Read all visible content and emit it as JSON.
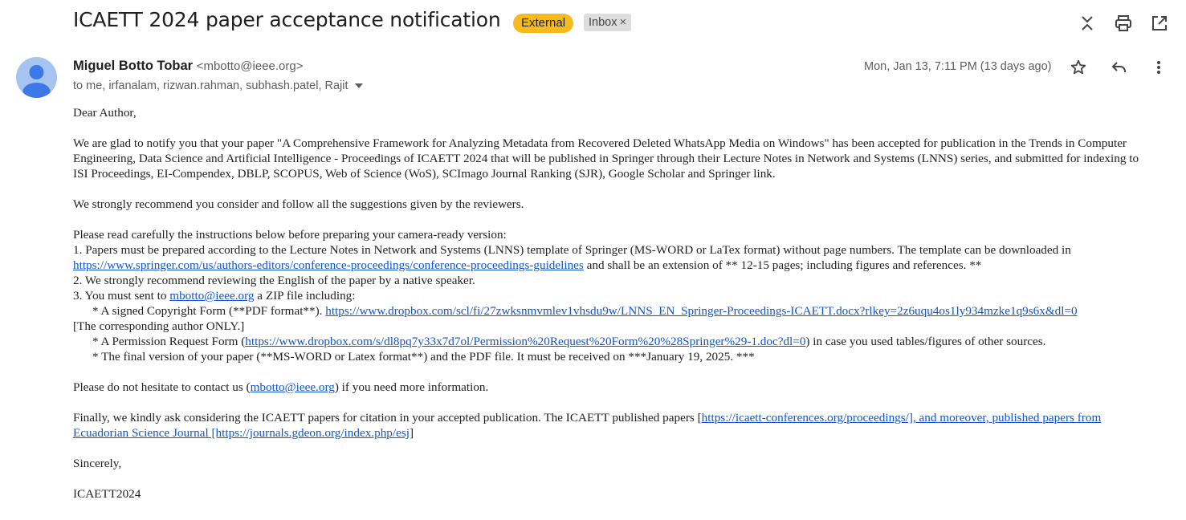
{
  "header": {
    "subject": "ICAETT 2024 paper acceptance notification",
    "label_external": "External",
    "label_inbox": "Inbox",
    "label_remove": "×",
    "icons": [
      "expand-collapse-icon",
      "print-icon",
      "open-in-new-window-icon"
    ]
  },
  "message": {
    "sender_name": "Miguel Botto Tobar",
    "sender_email": "<mbotto@ieee.org>",
    "recipients": "to me, irfanalam, rizwan.rahman, subhash.patel, Rajit",
    "date": "Mon, Jan 13, 7:11 PM (13 days ago)",
    "icons": [
      "star-icon",
      "reply-icon",
      "more-vert-icon"
    ]
  },
  "body": {
    "greeting": "Dear Author,",
    "p1": "We are glad to notify you that your paper \"A Comprehensive Framework for Analyzing Metadata from Recovered Deleted WhatsApp Media on Windows\" has been accepted for publication in the Trends in Computer Engineering, Data Science and Artificial Intelligence - Proceedings of ICAETT 2024 that will be published in Springer through their Lecture Notes in Network and Systems (LNNS) series, and submitted for indexing to ISI Proceedings, EI-Compendex, DBLP, SCOPUS, Web of Science (WoS), SCImago Journal Ranking (SJR), Google Scholar and Springer link.",
    "p2": "We strongly recommend you consider and follow all the suggestions given by the reviewers.",
    "p3_intro": "Please read carefully the instructions below before preparing your camera-ready version:",
    "item1_a": "1. Papers must be prepared according to the Lecture Notes in Network and Systems (LNNS) template of Springer (MS-WORD or LaTex format) without page numbers. The template can be downloaded in ",
    "item1_link": "https://www.springer.com/us/authors-editors/conference-proceedings/conference-proceedings-guidelines",
    "item1_b": " and shall be an extension of ** 12-15 pages; including figures and references. **",
    "item2": "2. We strongly recommend reviewing the English of the paper by a native speaker.",
    "item3_a": "3. You must sent to ",
    "item3_link": "mbotto@ieee.org",
    "item3_b": " a ZIP file including:",
    "sub1_a": "* A signed Copyright Form (**PDF format**). ",
    "sub1_link": "https://www.dropbox.com/scl/fi/27zwksnmvmlev1vhsdu9w/LNNS_EN_Springer-Proceedings-ICAETT.docx?rlkey=2z6uqu4os1ly934mzke1q9s6x&dl=0",
    "sub1_b": " [The corresponding author ONLY.]",
    "sub2_a": "* A Permission Request Form (",
    "sub2_link": "https://www.dropbox.com/s/dl8pq7y33x7d7ol/Permission%20Request%20Form%20%28Springer%29-1.doc?dl=0",
    "sub2_b": ") in case you used tables/figures of other sources.",
    "sub3": "* The final version of your paper (**MS-WORD or Latex format**) and the PDF file. It must be received on ***January 19, 2025. ***",
    "p4_a": "Please do not hesitate to contact us (",
    "p4_link": "mbotto@ieee.org",
    "p4_b": ") if you need more information.",
    "p5_a": "Finally, we kindly ask considering the ICAETT papers for citation in your accepted publication. The ICAETT published papers [",
    "p5_link": "https://icaett-conferences.org/proceedings/], and moreover, published papers from Ecuadorian Science Journal [https://journals.gdeon.org/index.php/esj",
    "p5_b": "]",
    "closing": "Sincerely,",
    "signature": "ICAETT2024"
  },
  "colors": {
    "external_badge": "#f5bb1e",
    "inbox_badge": "#dddddd",
    "link": "#1155cc",
    "avatar_bg": "#a7c3f0",
    "avatar_fg": "#3c79e6"
  }
}
